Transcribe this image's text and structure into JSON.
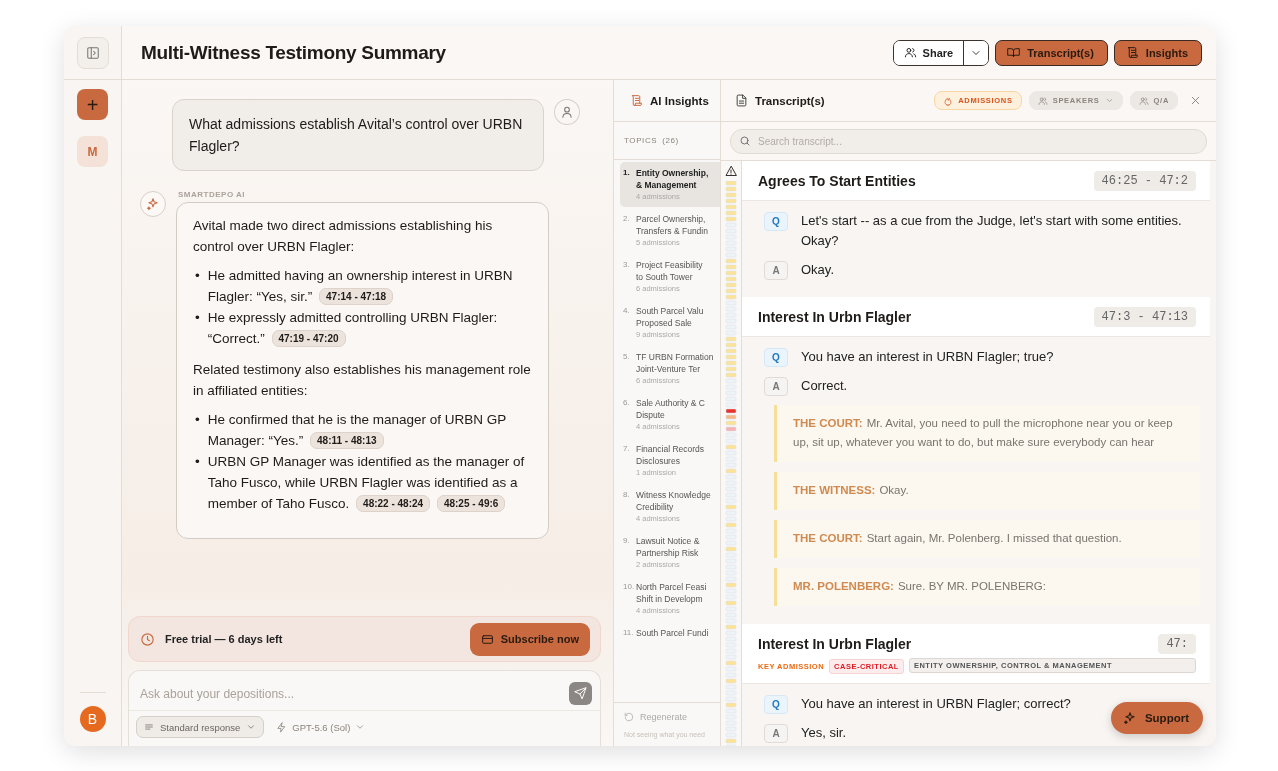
{
  "rail": {
    "new_chat_symbol": "+",
    "workspace_initial": "M",
    "user_initial": "B"
  },
  "header": {
    "title": "Multi-Witness Testimony Summary",
    "buttons": [
      {
        "kind": "share",
        "label": "Share"
      },
      {
        "kind": "filled",
        "label": "Transcript(s)"
      },
      {
        "kind": "filled",
        "label": "Insights"
      }
    ]
  },
  "chat": {
    "question": "What admissions establish Avital’s control over URBN Flagler?",
    "answer_label": "SMARTDEPO AI",
    "answer": [
      {
        "kind": "paragraph",
        "text": "Avital made two direct admissions establishing his control over URBN Flagler:"
      },
      {
        "kind": "bullets",
        "marker": "•",
        "items": [
          {
            "text": "He admitted having an ownership interest in URBN Flagler: “Yes, sir.”",
            "citations": [
              "47:14 - 47:18"
            ]
          },
          {
            "text": "He expressly admitted controlling URBN Flagler: “Correct.”",
            "citations": [
              "47:19 - 47:20"
            ]
          }
        ]
      },
      {
        "kind": "paragraph",
        "text": "Related testimony also establishes his management role in affiliated entities:"
      },
      {
        "kind": "bullets",
        "marker": "•",
        "items": [
          {
            "text": "He confirmed that he is the manager of URBN GP Manager: “Yes.”",
            "citations": [
              "48:11 - 48:13"
            ]
          },
          {
            "text": "URBN GP Manager was identified as the manager of Taho Fusco, while URBN Flagler was identified as a member of Taho Fusco.",
            "citations": [
              "48:22 - 48:24",
              "48:25 - 49:6"
            ]
          }
        ]
      }
    ],
    "trial": {
      "text": "Free trial — 6 days left",
      "button": "Subscribe now"
    },
    "input": {
      "placeholder": "Ask about your depositions...",
      "mode": "Standard response",
      "model": "GPT-5.6 (Sol)"
    }
  },
  "insights": {
    "title": "AI Insights",
    "topics_label": "TOPICS",
    "topics_count": "(26)",
    "topics": [
      {
        "number": "1.",
        "lines": [
          "Entity Ownership,",
          "& Management"
        ],
        "count": "4 admissions",
        "selected": true
      },
      {
        "number": "2.",
        "lines": [
          "Parcel Ownership,",
          "Transfers & Fundin"
        ],
        "count": "5 admissions",
        "selected": false
      },
      {
        "number": "3.",
        "lines": [
          "Project Feasibility",
          "to South Tower"
        ],
        "count": "6 admissions",
        "selected": false
      },
      {
        "number": "4.",
        "lines": [
          "South Parcel Valu",
          "Proposed Sale"
        ],
        "count": "9 admissions",
        "selected": false
      },
      {
        "number": "5.",
        "lines": [
          "TF URBN Formation",
          "Joint-Venture Ter"
        ],
        "count": "6 admissions",
        "selected": false
      },
      {
        "number": "6.",
        "lines": [
          "Sale Authority & C",
          "Dispute"
        ],
        "count": "4 admissions",
        "selected": false
      },
      {
        "number": "7.",
        "lines": [
          "Financial Records",
          "Disclosures"
        ],
        "count": "1 admission",
        "selected": false
      },
      {
        "number": "8.",
        "lines": [
          "Witness Knowledge",
          "Credibility"
        ],
        "count": "4 admissions",
        "selected": false
      },
      {
        "number": "9.",
        "lines": [
          "Lawsuit Notice &",
          "Partnership Risk"
        ],
        "count": "2 admissions",
        "selected": false
      },
      {
        "number": "10.",
        "lines": [
          "North Parcel Feasi",
          "Shift in Developm"
        ],
        "count": "4 admissions",
        "selected": false
      },
      {
        "number": "11.",
        "lines": [
          "South Parcel Fundi"
        ],
        "selected": false
      }
    ],
    "regenerate": "Regenerate",
    "hint": "Not seeing what you need"
  },
  "transcript": {
    "title": "Transcript(s)",
    "filters": [
      {
        "label": "ADMISSIONS",
        "kind": "admissions",
        "selected": true
      },
      {
        "label": "SPEAKERS",
        "kind": "speakers",
        "selected": false
      },
      {
        "label": "Q/A",
        "kind": "qa",
        "selected": false
      }
    ],
    "search_placeholder": "Search transcript...",
    "sections": [
      {
        "title": "Agrees To Start Entities",
        "time": "46:25 - 47:2",
        "lines": [
          {
            "kind": "q",
            "badge": "Q",
            "text": "Let's start -- as a cue from the Judge, let's start with some entities. Okay?"
          },
          {
            "kind": "a",
            "badge": "A",
            "text": "Okay."
          }
        ]
      },
      {
        "title": "Interest In Urbn Flagler",
        "time": "47:3 - 47:13",
        "lines": [
          {
            "kind": "q",
            "badge": "Q",
            "text": "You have an interest in URBN Flagler; true?"
          },
          {
            "kind": "a",
            "badge": "A",
            "text": "Correct."
          },
          {
            "kind": "speaker",
            "speaker": "THE COURT:",
            "text": "Mr. Avital, you need to pull the microphone near you or keep up, sit up, whatever you want to do, but make sure everybody can hear"
          },
          {
            "kind": "speaker",
            "speaker": "THE WITNESS:",
            "text": "Okay."
          },
          {
            "kind": "speaker",
            "speaker": "THE COURT:",
            "text": "Start again, Mr. Polenberg. I missed that question."
          },
          {
            "kind": "speaker",
            "speaker": "MR. POLENBERG:",
            "text": "Sure. BY MR. POLENBERG:"
          }
        ]
      },
      {
        "title": "Interest In Urbn Flagler",
        "time": "47:",
        "tags": [
          {
            "kind": "key",
            "label": "KEY ADMISSION"
          },
          {
            "kind": "critical",
            "label": "CASE-CRITICAL"
          },
          {
            "kind": "topic",
            "label": "ENTITY OWNERSHIP, CONTROL & MANAGEMENT"
          }
        ],
        "lines": [
          {
            "kind": "q",
            "badge": "Q",
            "text": "You have an interest in URBN Flagler; correct?"
          },
          {
            "kind": "a",
            "badge": "A",
            "text": "Yes, sir."
          }
        ]
      }
    ]
  },
  "support": {
    "label": "Support"
  }
}
